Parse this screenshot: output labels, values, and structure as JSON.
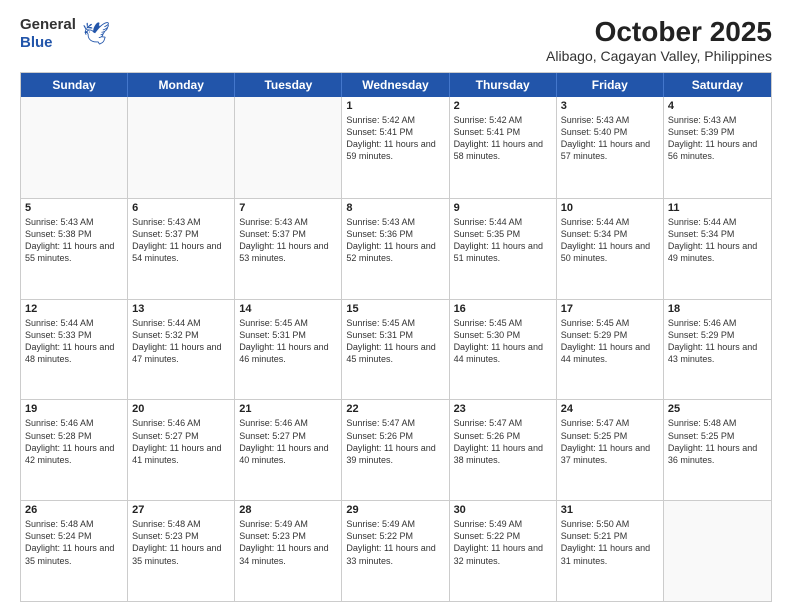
{
  "header": {
    "logo_general": "General",
    "logo_blue": "Blue",
    "month_title": "October 2025",
    "location": "Alibago, Cagayan Valley, Philippines"
  },
  "weekdays": [
    "Sunday",
    "Monday",
    "Tuesday",
    "Wednesday",
    "Thursday",
    "Friday",
    "Saturday"
  ],
  "weeks": [
    [
      {
        "day": "",
        "empty": true
      },
      {
        "day": "",
        "empty": true
      },
      {
        "day": "",
        "empty": true
      },
      {
        "day": "1",
        "sunrise": "5:42 AM",
        "sunset": "5:41 PM",
        "daylight": "11 hours and 59 minutes."
      },
      {
        "day": "2",
        "sunrise": "5:42 AM",
        "sunset": "5:41 PM",
        "daylight": "11 hours and 58 minutes."
      },
      {
        "day": "3",
        "sunrise": "5:43 AM",
        "sunset": "5:40 PM",
        "daylight": "11 hours and 57 minutes."
      },
      {
        "day": "4",
        "sunrise": "5:43 AM",
        "sunset": "5:39 PM",
        "daylight": "11 hours and 56 minutes."
      }
    ],
    [
      {
        "day": "5",
        "sunrise": "5:43 AM",
        "sunset": "5:38 PM",
        "daylight": "11 hours and 55 minutes."
      },
      {
        "day": "6",
        "sunrise": "5:43 AM",
        "sunset": "5:37 PM",
        "daylight": "11 hours and 54 minutes."
      },
      {
        "day": "7",
        "sunrise": "5:43 AM",
        "sunset": "5:37 PM",
        "daylight": "11 hours and 53 minutes."
      },
      {
        "day": "8",
        "sunrise": "5:43 AM",
        "sunset": "5:36 PM",
        "daylight": "11 hours and 52 minutes."
      },
      {
        "day": "9",
        "sunrise": "5:44 AM",
        "sunset": "5:35 PM",
        "daylight": "11 hours and 51 minutes."
      },
      {
        "day": "10",
        "sunrise": "5:44 AM",
        "sunset": "5:34 PM",
        "daylight": "11 hours and 50 minutes."
      },
      {
        "day": "11",
        "sunrise": "5:44 AM",
        "sunset": "5:34 PM",
        "daylight": "11 hours and 49 minutes."
      }
    ],
    [
      {
        "day": "12",
        "sunrise": "5:44 AM",
        "sunset": "5:33 PM",
        "daylight": "11 hours and 48 minutes."
      },
      {
        "day": "13",
        "sunrise": "5:44 AM",
        "sunset": "5:32 PM",
        "daylight": "11 hours and 47 minutes."
      },
      {
        "day": "14",
        "sunrise": "5:45 AM",
        "sunset": "5:31 PM",
        "daylight": "11 hours and 46 minutes."
      },
      {
        "day": "15",
        "sunrise": "5:45 AM",
        "sunset": "5:31 PM",
        "daylight": "11 hours and 45 minutes."
      },
      {
        "day": "16",
        "sunrise": "5:45 AM",
        "sunset": "5:30 PM",
        "daylight": "11 hours and 44 minutes."
      },
      {
        "day": "17",
        "sunrise": "5:45 AM",
        "sunset": "5:29 PM",
        "daylight": "11 hours and 44 minutes."
      },
      {
        "day": "18",
        "sunrise": "5:46 AM",
        "sunset": "5:29 PM",
        "daylight": "11 hours and 43 minutes."
      }
    ],
    [
      {
        "day": "19",
        "sunrise": "5:46 AM",
        "sunset": "5:28 PM",
        "daylight": "11 hours and 42 minutes."
      },
      {
        "day": "20",
        "sunrise": "5:46 AM",
        "sunset": "5:27 PM",
        "daylight": "11 hours and 41 minutes."
      },
      {
        "day": "21",
        "sunrise": "5:46 AM",
        "sunset": "5:27 PM",
        "daylight": "11 hours and 40 minutes."
      },
      {
        "day": "22",
        "sunrise": "5:47 AM",
        "sunset": "5:26 PM",
        "daylight": "11 hours and 39 minutes."
      },
      {
        "day": "23",
        "sunrise": "5:47 AM",
        "sunset": "5:26 PM",
        "daylight": "11 hours and 38 minutes."
      },
      {
        "day": "24",
        "sunrise": "5:47 AM",
        "sunset": "5:25 PM",
        "daylight": "11 hours and 37 minutes."
      },
      {
        "day": "25",
        "sunrise": "5:48 AM",
        "sunset": "5:25 PM",
        "daylight": "11 hours and 36 minutes."
      }
    ],
    [
      {
        "day": "26",
        "sunrise": "5:48 AM",
        "sunset": "5:24 PM",
        "daylight": "11 hours and 35 minutes."
      },
      {
        "day": "27",
        "sunrise": "5:48 AM",
        "sunset": "5:23 PM",
        "daylight": "11 hours and 35 minutes."
      },
      {
        "day": "28",
        "sunrise": "5:49 AM",
        "sunset": "5:23 PM",
        "daylight": "11 hours and 34 minutes."
      },
      {
        "day": "29",
        "sunrise": "5:49 AM",
        "sunset": "5:22 PM",
        "daylight": "11 hours and 33 minutes."
      },
      {
        "day": "30",
        "sunrise": "5:49 AM",
        "sunset": "5:22 PM",
        "daylight": "11 hours and 32 minutes."
      },
      {
        "day": "31",
        "sunrise": "5:50 AM",
        "sunset": "5:21 PM",
        "daylight": "11 hours and 31 minutes."
      },
      {
        "day": "",
        "empty": true
      }
    ]
  ]
}
